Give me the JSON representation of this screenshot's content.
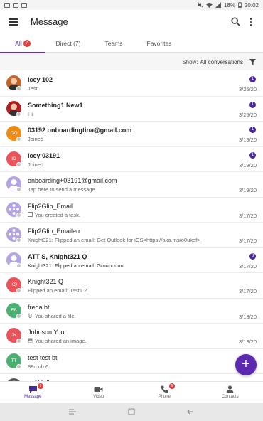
{
  "status_bar": {
    "battery": "18%",
    "time": "20:02"
  },
  "app_bar": {
    "title": "Message"
  },
  "tabs": [
    {
      "label": "All",
      "badge": "7",
      "active": true
    },
    {
      "label": "Direct (7)"
    },
    {
      "label": "Teams"
    },
    {
      "label": "Favorites"
    }
  ],
  "filter": {
    "show_label": "Show:",
    "value": "All conversations"
  },
  "conversations": [
    {
      "name": "Icey 102",
      "preview": "Test",
      "date": "3/25/20",
      "unread": "1",
      "bold": true,
      "avatar": {
        "type": "photo",
        "color": "#c0642c"
      }
    },
    {
      "name": "Something1 New1",
      "preview": "Hi",
      "date": "3/25/20",
      "unread": "1",
      "bold": true,
      "avatar": {
        "type": "photo",
        "color": "#b31f22"
      }
    },
    {
      "name": "03192 onboardingtina@gmail.com",
      "preview": "Joined",
      "date": "3/19/20",
      "unread": "1",
      "bold": true,
      "avatar": {
        "type": "initials",
        "initials": "OO",
        "color": "#ef8a13"
      }
    },
    {
      "name": "Icey 03191",
      "preview": "Joined",
      "date": "3/19/20",
      "unread": "1",
      "bold": true,
      "avatar": {
        "type": "initials",
        "initials": "ID",
        "color": "#e8545a"
      }
    },
    {
      "name": "onboarding+03191@gmail.com",
      "preview": "Tap here to send a message.",
      "date": "3/19/20",
      "bold": false,
      "avatar": {
        "type": "person",
        "color": "#b5a4e3"
      }
    },
    {
      "name": "Flip2Glip_Email",
      "preview": "You created a task.",
      "date": "3/17/20",
      "bold": false,
      "preview_icon": "task-checkbox-icon",
      "avatar": {
        "type": "team",
        "color": "#b5a4e3"
      }
    },
    {
      "name": "Flip2Glip_Emailerr",
      "preview": "Knight321: Flipped an email:  Get Outlook for iOS<https://aka.ms/o0ukef>",
      "date": "3/17/20",
      "bold": false,
      "avatar": {
        "type": "team",
        "color": "#b5a4e3"
      }
    },
    {
      "name": "ATT S, Knight321 Q",
      "preview": "Knight321: Flipped an email:  Groupuuuu",
      "date": "3/17/20",
      "unread": "3",
      "bold": true,
      "strong_preview": true,
      "avatar": {
        "type": "person",
        "color": "#b5a4e3"
      }
    },
    {
      "name": "Knight321 Q",
      "preview": "Flipped an email:  Test1.2",
      "date": "3/17/20",
      "bold": false,
      "avatar": {
        "type": "initials",
        "initials": "KQ",
        "color": "#e8545a"
      }
    },
    {
      "name": "freda bt",
      "preview": "You shared a file.",
      "date": "3/13/20",
      "bold": false,
      "preview_icon": "file-icon",
      "avatar": {
        "type": "initials",
        "initials": "FB",
        "color": "#4caf72"
      }
    },
    {
      "name": "Johnson You",
      "preview": "You shared an image.",
      "date": "3/13/20",
      "bold": false,
      "preview_icon": "image-icon",
      "avatar": {
        "type": "initials",
        "initials": "JY",
        "color": "#e8545a"
      }
    },
    {
      "name": "test test bt",
      "preview": "88o uh 6",
      "date": "",
      "bold": false,
      "avatar": {
        "type": "initials",
        "initials": "TT",
        "color": "#4caf72"
      }
    },
    {
      "name": "...   N.b.ll",
      "preview": "",
      "date": "",
      "bold": false,
      "avatar": {
        "type": "photo",
        "color": "#555555"
      }
    }
  ],
  "fab": {
    "label": "+"
  },
  "bottom_nav": [
    {
      "label": "Message",
      "icon": "message-icon",
      "badge": "7",
      "active": true
    },
    {
      "label": "Video",
      "icon": "video-icon"
    },
    {
      "label": "Phone",
      "icon": "phone-icon",
      "badge": "6"
    },
    {
      "label": "Contacts",
      "icon": "contacts-icon"
    }
  ],
  "colors": {
    "accent": "#5b2fad",
    "badge_red": "#e0413f",
    "unread_badge": "#4a2a9a"
  }
}
